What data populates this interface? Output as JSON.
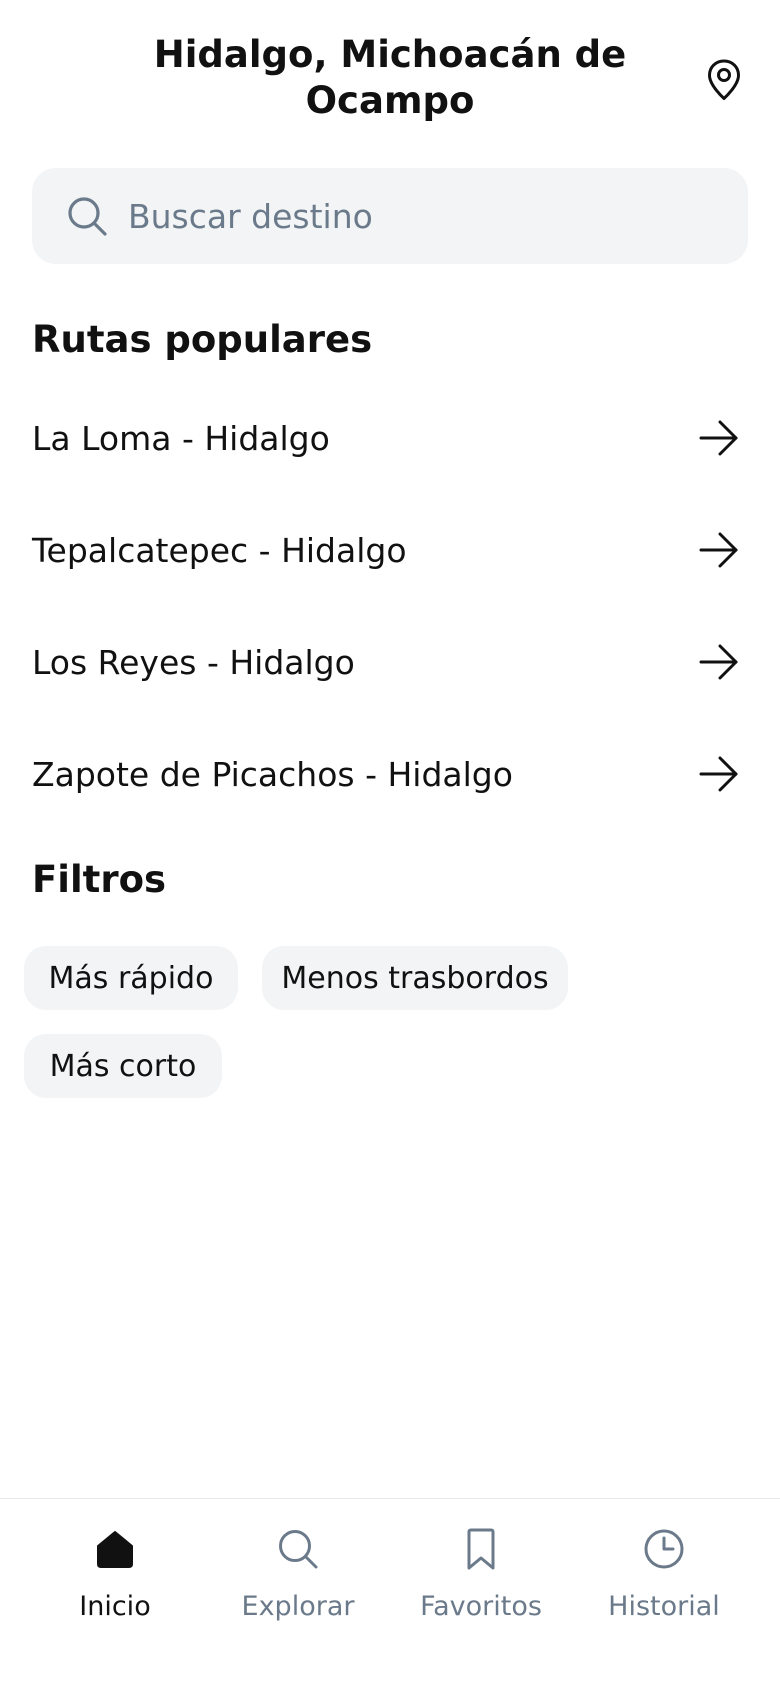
{
  "header": {
    "title": "Hidalgo, Michoacán de Ocampo",
    "location_icon": "map-pin-icon"
  },
  "search": {
    "placeholder": "Buscar destino",
    "value": "",
    "icon": "search-icon"
  },
  "routes": {
    "title": "Rutas populares",
    "items": [
      {
        "label": "La Loma - Hidalgo",
        "icon": "arrow-right-icon"
      },
      {
        "label": "Tepalcatepec - Hidalgo",
        "icon": "arrow-right-icon"
      },
      {
        "label": "Los Reyes - Hidalgo",
        "icon": "arrow-right-icon"
      },
      {
        "label": "Zapote de Picachos - Hidalgo",
        "icon": "arrow-right-icon"
      }
    ]
  },
  "filters": {
    "title": "Filtros",
    "chips": [
      {
        "label": "Más rápido"
      },
      {
        "label": "Menos trasbordos"
      },
      {
        "label": "Más corto"
      }
    ]
  },
  "bottom_nav": {
    "items": [
      {
        "label": "Inicio",
        "icon": "home-icon",
        "active": true
      },
      {
        "label": "Explorar",
        "icon": "search-icon",
        "active": false
      },
      {
        "label": "Favoritos",
        "icon": "bookmark-icon",
        "active": false
      },
      {
        "label": "Historial",
        "icon": "clock-icon",
        "active": false
      }
    ]
  },
  "colors": {
    "text_primary": "#111111",
    "text_muted": "#6b7a8a",
    "surface": "#f2f4f5",
    "background": "#ffffff"
  }
}
